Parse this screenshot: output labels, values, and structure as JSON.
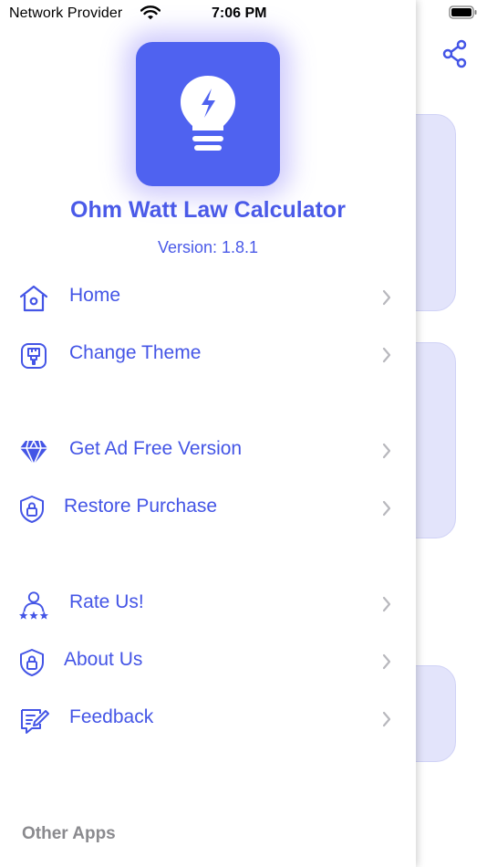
{
  "status_bar": {
    "carrier": "Network Provider",
    "time": "7:06 PM"
  },
  "app": {
    "title": "Ohm Watt Law Calculator",
    "version": "Version: 1.8.1",
    "icon": "lightbulb-bolt-icon",
    "accent_color": "#4f62f0"
  },
  "menu": {
    "groups": [
      [
        {
          "label": "Home",
          "icon": "home-icon"
        },
        {
          "label": "Change Theme",
          "icon": "paintbrush-icon"
        }
      ],
      [
        {
          "label": "Get Ad Free Version",
          "icon": "diamond-icon"
        },
        {
          "label": "Restore Purchase",
          "icon": "shield-lock-icon"
        }
      ],
      [
        {
          "label": "Rate Us!",
          "icon": "user-stars-icon"
        },
        {
          "label": "About Us",
          "icon": "shield-lock-icon"
        },
        {
          "label": "Feedback",
          "icon": "edit-note-icon"
        }
      ]
    ]
  },
  "section_footer": {
    "other_apps": "Other Apps"
  },
  "background": {
    "share_icon": "share-icon"
  }
}
